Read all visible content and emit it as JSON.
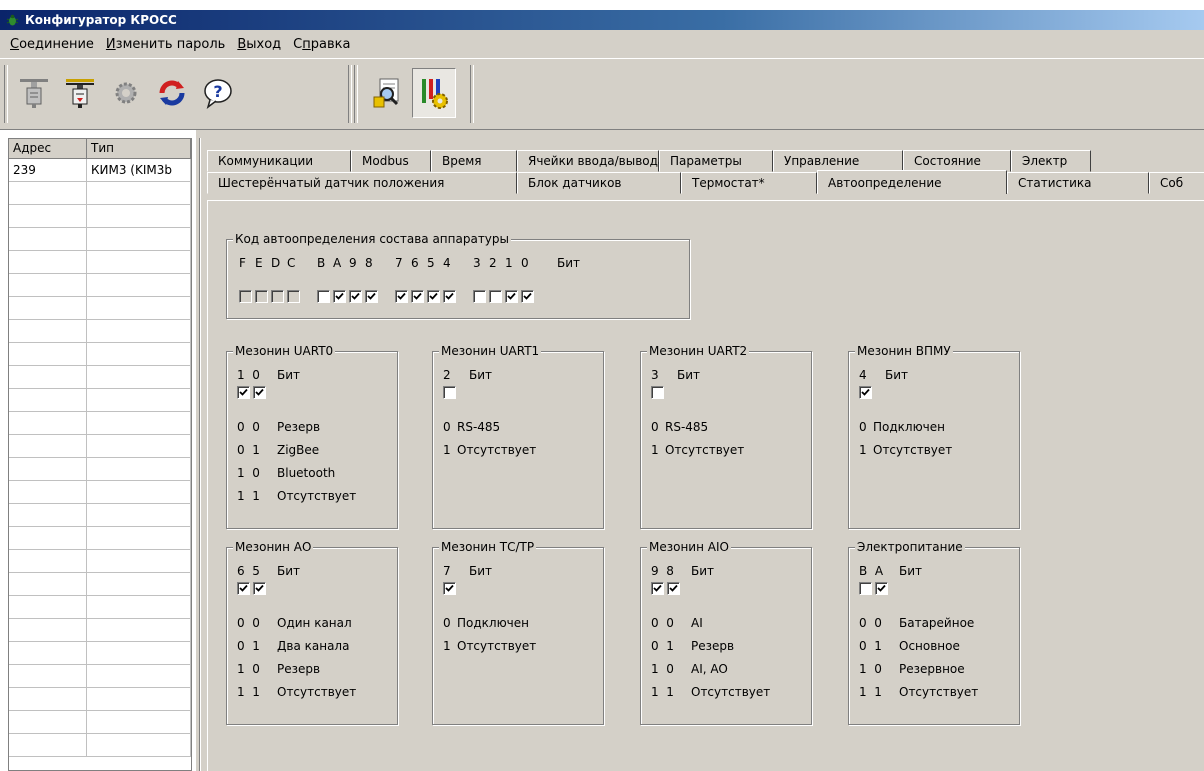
{
  "window": {
    "title": "Конфигуратор КРОСС"
  },
  "menu": [
    {
      "pre": "",
      "acc": "С",
      "post": "оединение"
    },
    {
      "pre": "",
      "acc": "И",
      "post": "зменить пароль"
    },
    {
      "pre": "",
      "acc": "В",
      "post": "ыход"
    },
    {
      "pre": "С",
      "acc": "п",
      "post": "равка"
    }
  ],
  "toolbar": {
    "buttons": [
      "connect-icon",
      "disconnect-icon",
      "settings-gear-icon",
      "refresh-icon",
      "help-icon",
      "autodetect-icon",
      "tools-icon"
    ],
    "pressed": "tools-icon"
  },
  "device_list": {
    "columns": [
      "Адрес",
      "Тип"
    ],
    "rows": [
      [
        "239",
        "КИМ3 (KIM3b"
      ]
    ]
  },
  "tabs": {
    "row1": [
      "Коммуникации",
      "Modbus",
      "Время",
      "Ячейки ввода/вывода",
      "Параметры",
      "Управление",
      "Состояние",
      "Электр"
    ],
    "row2": [
      "Шестерёнчатый датчик положения",
      "Блок датчиков",
      "Термостат*",
      "Автоопределение",
      "Статистика",
      "Соб"
    ],
    "active": "Автоопределение"
  },
  "autodetect": {
    "title": "Код автоопределения состава аппаратуры",
    "bit_groups": [
      {
        "labels": [
          "F",
          "E",
          "D",
          "C"
        ],
        "checked": [
          false,
          false,
          false,
          false
        ],
        "disabled": true
      },
      {
        "labels": [
          "B",
          "A",
          "9",
          "8"
        ],
        "checked": [
          false,
          true,
          true,
          true
        ],
        "disabled": false
      },
      {
        "labels": [
          "7",
          "6",
          "5",
          "4"
        ],
        "checked": [
          true,
          true,
          true,
          true
        ],
        "disabled": false
      },
      {
        "labels": [
          "3",
          "2",
          "1",
          "0"
        ],
        "checked": [
          false,
          false,
          true,
          true
        ],
        "disabled": false
      }
    ],
    "bit_word": "Бит"
  },
  "mezzanines": [
    {
      "title": "Мезонин UART0",
      "bits": "1  0",
      "bit_word": "Бит",
      "checks": [
        true,
        true
      ],
      "rows": [
        [
          "0  0",
          "Резерв"
        ],
        [
          "0  1",
          "ZigBee"
        ],
        [
          "1  0",
          "Bluetooth"
        ],
        [
          "1  1",
          "Отсутствует"
        ]
      ]
    },
    {
      "title": "Мезонин UART1",
      "bits": "2",
      "bit_word": "Бит",
      "checks": [
        false
      ],
      "rows": [
        [
          "0",
          "RS-485"
        ],
        [
          "1",
          "Отсутствует"
        ]
      ]
    },
    {
      "title": "Мезонин UART2",
      "bits": "3",
      "bit_word": "Бит",
      "checks": [
        false
      ],
      "rows": [
        [
          "0",
          "RS-485"
        ],
        [
          "1",
          "Отсутствует"
        ]
      ]
    },
    {
      "title": "Мезонин ВПМУ",
      "bits": "4",
      "bit_word": "Бит",
      "checks": [
        true
      ],
      "rows": [
        [
          "0",
          "Подключен"
        ],
        [
          "1",
          "Отсутствует"
        ]
      ]
    },
    {
      "title": "Мезонин АО",
      "bits": "6  5",
      "bit_word": "Бит",
      "checks": [
        true,
        true
      ],
      "rows": [
        [
          "0  0",
          "Один канал"
        ],
        [
          "0  1",
          "Два канала"
        ],
        [
          "1  0",
          "Резерв"
        ],
        [
          "1  1",
          "Отсутствует"
        ]
      ]
    },
    {
      "title": "Мезонин ТС/ТР",
      "bits": "7",
      "bit_word": "Бит",
      "checks": [
        true
      ],
      "rows": [
        [
          "0",
          "Подключен"
        ],
        [
          "1",
          "Отсутствует"
        ]
      ]
    },
    {
      "title": "Мезонин AIO",
      "bits": "9  8",
      "bit_word": "Бит",
      "checks": [
        true,
        true
      ],
      "rows": [
        [
          "0  0",
          "AI"
        ],
        [
          "0  1",
          "Резерв"
        ],
        [
          "1  0",
          "AI, AO"
        ],
        [
          "1  1",
          "Отсутствует"
        ]
      ]
    },
    {
      "title": "Электропитание",
      "bits": "B  A",
      "bit_word": "Бит",
      "checks": [
        false,
        true
      ],
      "rows": [
        [
          "0  0",
          "Батарейное"
        ],
        [
          "0  1",
          "Основное"
        ],
        [
          "1  0",
          "Резервное"
        ],
        [
          "1  1",
          "Отсутствует"
        ]
      ]
    }
  ]
}
